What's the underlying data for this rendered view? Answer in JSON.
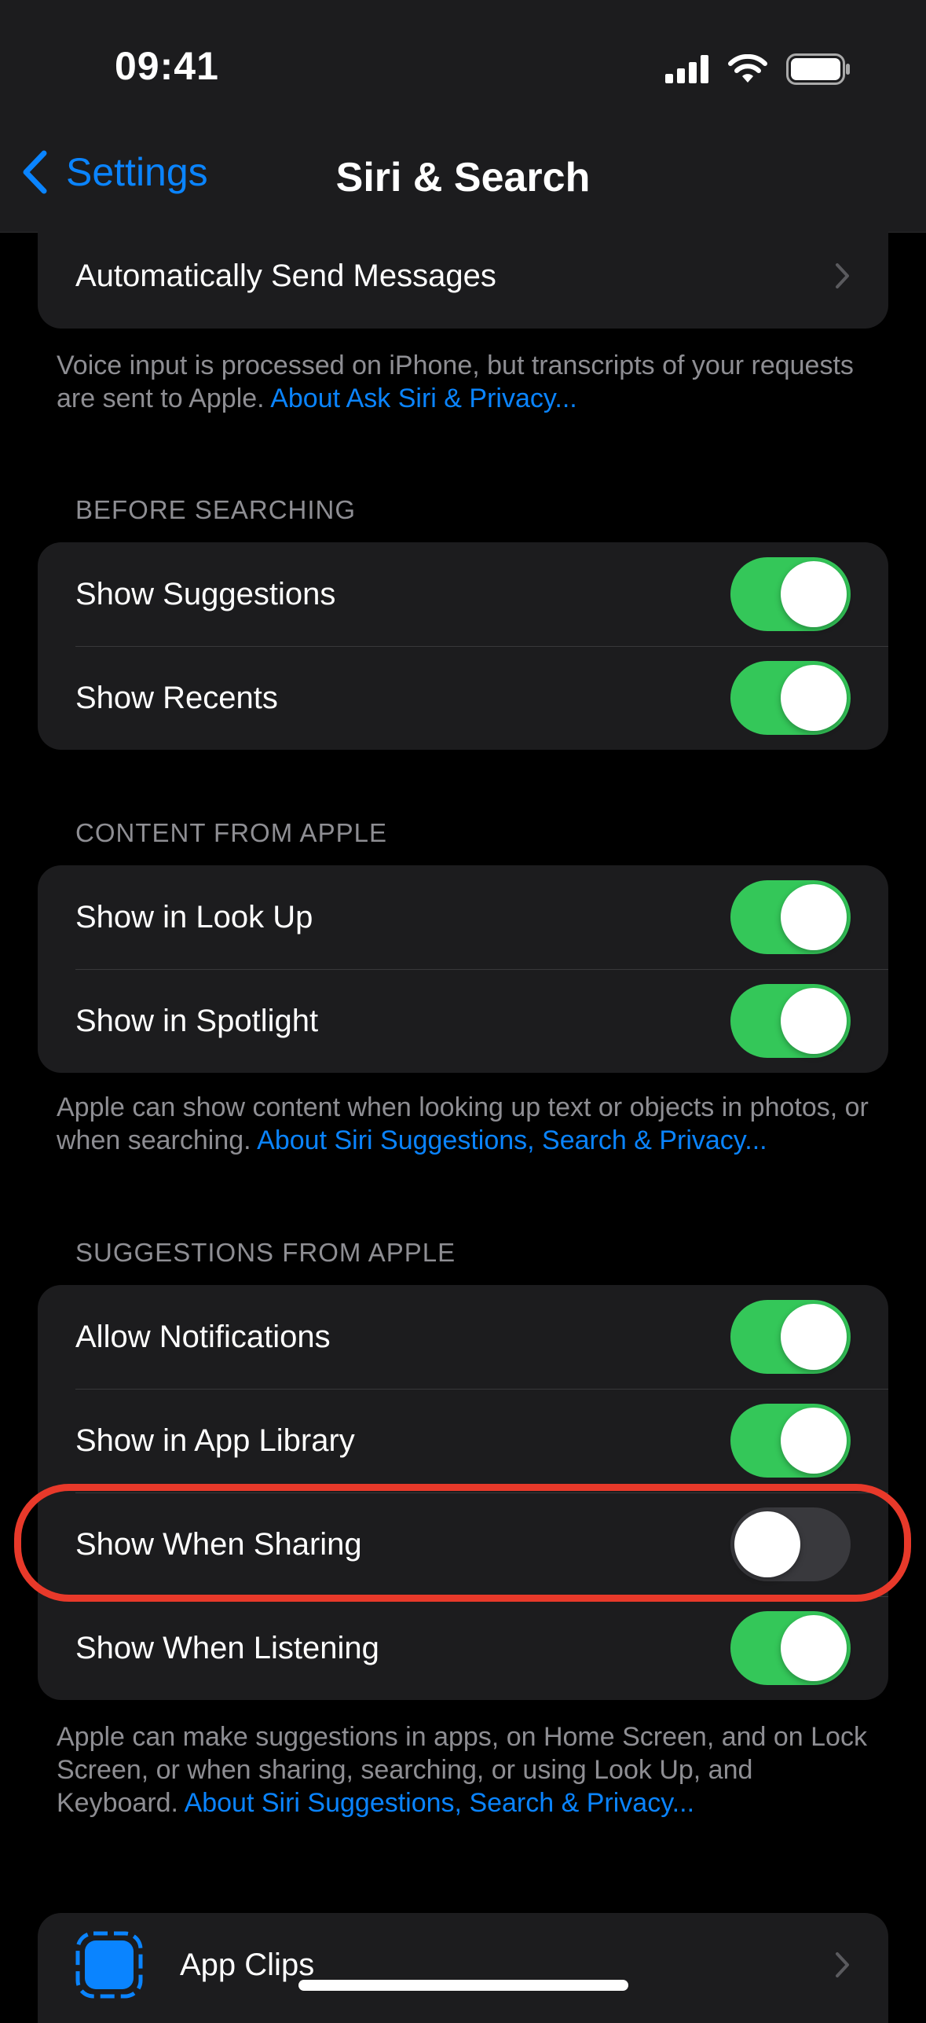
{
  "status_bar": {
    "time": "09:41"
  },
  "nav": {
    "back_label": "Settings",
    "title": "Siri & Search"
  },
  "top_group": {
    "row_label": "Automatically Send Messages"
  },
  "top_footer": {
    "text": "Voice input is processed on iPhone, but transcripts of your requests are sent to Apple. ",
    "link": "About Ask Siri & Privacy..."
  },
  "before_searching": {
    "header": "BEFORE SEARCHING",
    "rows": [
      {
        "label": "Show Suggestions",
        "on": true
      },
      {
        "label": "Show Recents",
        "on": true
      }
    ]
  },
  "content_from_apple": {
    "header": "CONTENT FROM APPLE",
    "rows": [
      {
        "label": "Show in Look Up",
        "on": true
      },
      {
        "label": "Show in Spotlight",
        "on": true
      }
    ],
    "footer_text": "Apple can show content when looking up text or objects in photos, or when searching. ",
    "footer_link": "About Siri Suggestions, Search & Privacy..."
  },
  "suggestions_from_apple": {
    "header": "SUGGESTIONS FROM APPLE",
    "rows": [
      {
        "label": "Allow Notifications",
        "on": true
      },
      {
        "label": "Show in App Library",
        "on": true
      },
      {
        "label": "Show When Sharing",
        "on": false
      },
      {
        "label": "Show When Listening",
        "on": true
      }
    ],
    "footer_text": "Apple can make suggestions in apps, on Home Screen, and on Lock Screen, or when sharing, searching, or using Look Up, and Keyboard. ",
    "footer_link": "About Siri Suggestions, Search & Privacy..."
  },
  "apps": {
    "rows": [
      {
        "label": "App Clips",
        "icon": "app-clips-icon"
      }
    ]
  },
  "colors": {
    "accent": "#0a84ff",
    "toggle_on": "#34c759",
    "highlight": "#e8392a",
    "background": "#000000",
    "cell": "#1c1c1e"
  }
}
